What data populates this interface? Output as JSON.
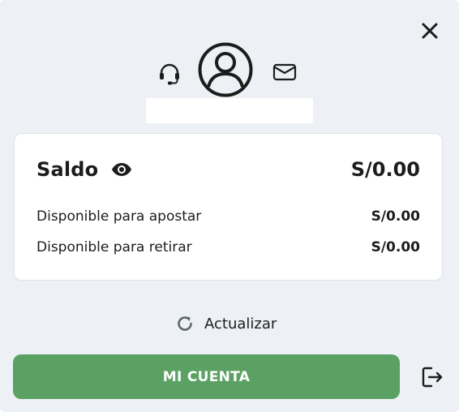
{
  "header": {
    "close_icon": "close-icon",
    "support_icon": "headset-icon",
    "avatar_icon": "user-circle-icon",
    "messages_icon": "mail-icon",
    "username": ""
  },
  "balance": {
    "title": "Saldo",
    "visibility_icon": "eye-icon",
    "total": "S/0.00",
    "rows": [
      {
        "label": "Disponible para apostar",
        "value": "S/0.00"
      },
      {
        "label": "Disponible para retirar",
        "value": "S/0.00"
      }
    ]
  },
  "refresh": {
    "icon": "refresh-icon",
    "label": "Actualizar"
  },
  "footer": {
    "account_label": "MI CUENTA",
    "logout_icon": "logout-icon"
  },
  "colors": {
    "panel_bg": "#edf0f4",
    "card_bg": "#ffffff",
    "primary_green": "#5aa163",
    "text": "#1c1c1c"
  }
}
